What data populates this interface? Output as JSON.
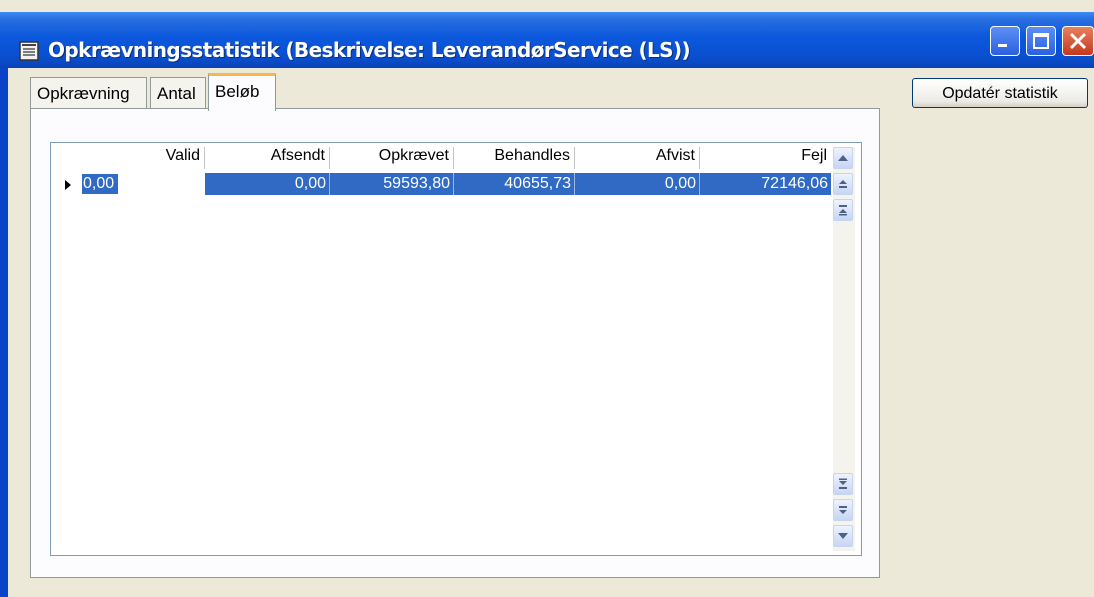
{
  "window": {
    "title": "Opkrævningsstatistik (Beskrivelse: LeverandørService (LS))"
  },
  "tabs": [
    {
      "label": "Opkrævning"
    },
    {
      "label": "Antal"
    },
    {
      "label": "Beløb"
    }
  ],
  "active_tab": "Beløb",
  "update_button": {
    "label": "Opdatér statistik"
  },
  "grid": {
    "columns": [
      "Valid",
      "Afsendt",
      "Opkrævet",
      "Behandles",
      "Afvist",
      "Fejl"
    ],
    "rows": [
      {
        "valid": "0,00",
        "afsendt": "0,00",
        "opkraevet": "59593,80",
        "behandles": "40655,73",
        "afvist": "0,00",
        "fejl": "72146,06"
      }
    ]
  },
  "colors": {
    "titlebar": "#0a4fcf",
    "selection": "#316ac5",
    "window_bg": "#ece9d8",
    "active_tab_accent": "#f4b94a"
  }
}
